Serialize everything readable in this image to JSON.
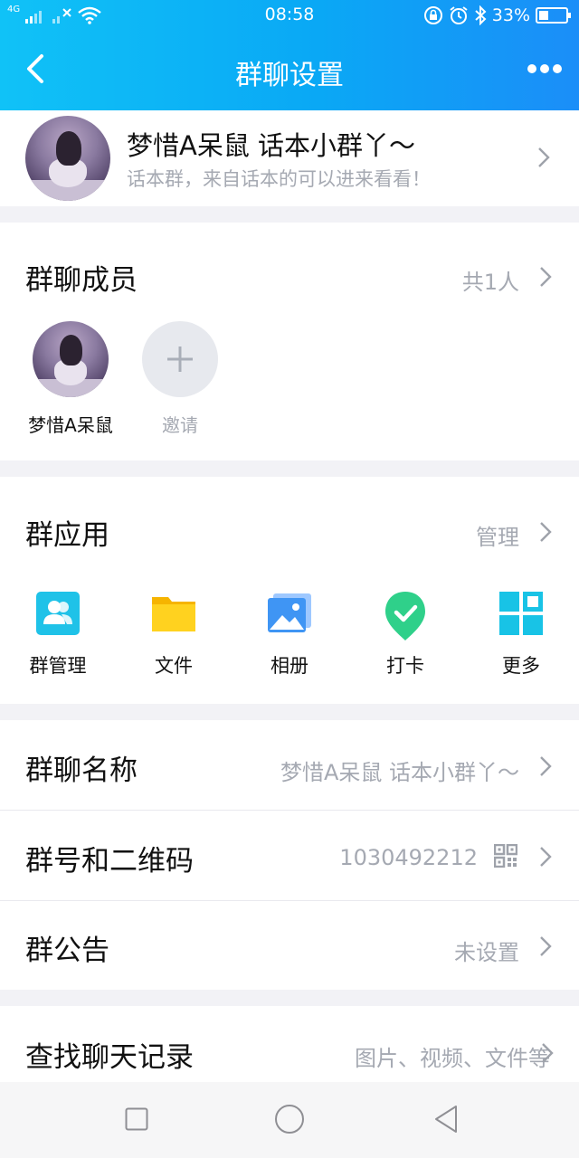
{
  "status_bar": {
    "network": "4G",
    "time": "08:58",
    "battery": "33%"
  },
  "nav": {
    "title": "群聊设置"
  },
  "group_info": {
    "name": "梦惜A呆鼠   话本小群丫～",
    "description": "话本群，来自话本的可以进来看看！"
  },
  "members": {
    "title": "群聊成员",
    "count_label": "共1人",
    "list": [
      {
        "name": "梦惜A呆鼠"
      }
    ],
    "invite_label": "邀请"
  },
  "apps": {
    "title": "群应用",
    "manage_label": "管理",
    "items": [
      {
        "label": "群管理",
        "icon": "group-manage-icon"
      },
      {
        "label": "文件",
        "icon": "folder-icon"
      },
      {
        "label": "相册",
        "icon": "album-icon"
      },
      {
        "label": "打卡",
        "icon": "checkin-icon"
      },
      {
        "label": "更多",
        "icon": "more-grid-icon"
      }
    ]
  },
  "settings": {
    "group_name": {
      "label": "群聊名称",
      "value": "梦惜A呆鼠   话本小群丫～"
    },
    "group_number": {
      "label": "群号和二维码",
      "value": "1030492212"
    },
    "announcement": {
      "label": "群公告",
      "value": "未设置"
    },
    "search_history": {
      "label": "查找聊天记录",
      "value": "图片、视频、文件等"
    }
  },
  "colors": {
    "header_start": "#10c2f7",
    "header_end": "#1b8ef8",
    "secondary_text": "#a5a9b2"
  }
}
